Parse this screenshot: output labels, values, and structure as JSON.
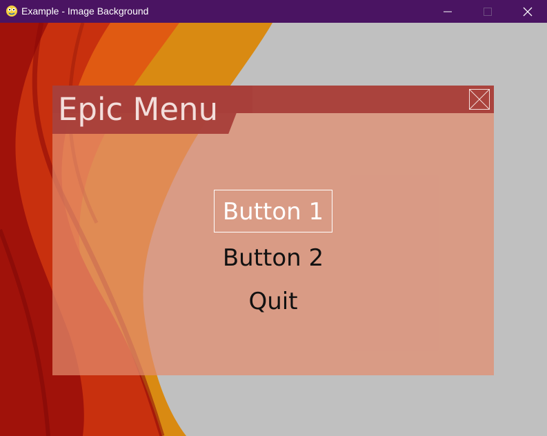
{
  "window": {
    "title": "Example - Image Background",
    "app_icon": "python-icon"
  },
  "controls": {
    "minimize": "minimize-icon",
    "maximize": "maximize-icon",
    "close": "close-icon"
  },
  "menu": {
    "title": "Epic Menu",
    "close_icon": "close-x-icon",
    "buttons": [
      {
        "label": "Button 1",
        "selected": true
      },
      {
        "label": "Button 2",
        "selected": false
      },
      {
        "label": "Quit",
        "selected": false
      }
    ]
  },
  "colors": {
    "titlebar": "#4a1462",
    "background": "#c0c0c0",
    "menu_header": "#a8403a",
    "menu_body": "#e28c6e"
  }
}
